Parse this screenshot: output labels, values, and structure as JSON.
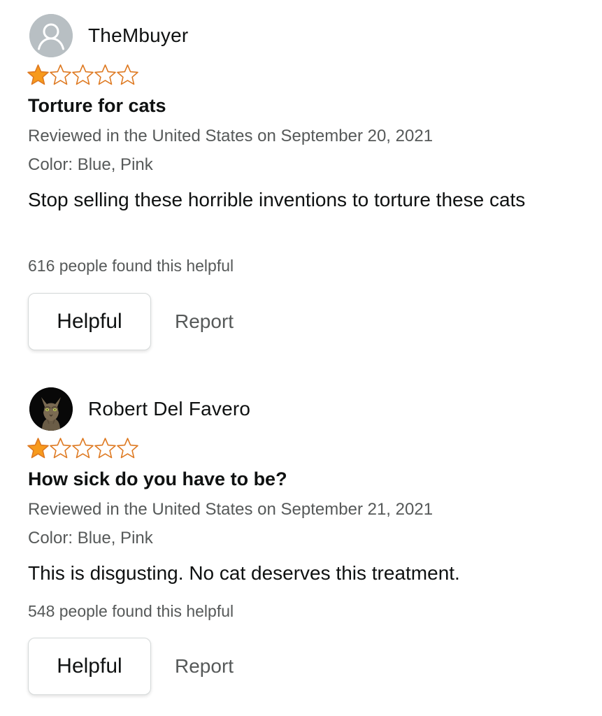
{
  "accent": {
    "star": "#f79a1c",
    "star_outline": "#de7921",
    "muted_text": "#565959"
  },
  "reviews": [
    {
      "reviewer": "TheMbuyer",
      "avatar": "default-avatar-icon",
      "rating": 1,
      "rating_max": 5,
      "title": "Torture for cats",
      "reviewed": "Reviewed in the United States on September 20, 2021",
      "color": "Color: Blue, Pink",
      "body": "Stop selling these horrible inventions to torture these cats",
      "helpful_count": "616 people found this helpful",
      "helpful_label": "Helpful",
      "report_label": "Report"
    },
    {
      "reviewer": "Robert Del Favero",
      "avatar": "cat-photo-avatar",
      "rating": 1,
      "rating_max": 5,
      "title": "How sick do you have to be?",
      "reviewed": "Reviewed in the United States on September 21, 2021",
      "color": "Color: Blue, Pink",
      "body": "This is disgusting. No cat deserves this treatment.",
      "helpful_count": "548 people found this helpful",
      "helpful_label": "Helpful",
      "report_label": "Report"
    }
  ]
}
